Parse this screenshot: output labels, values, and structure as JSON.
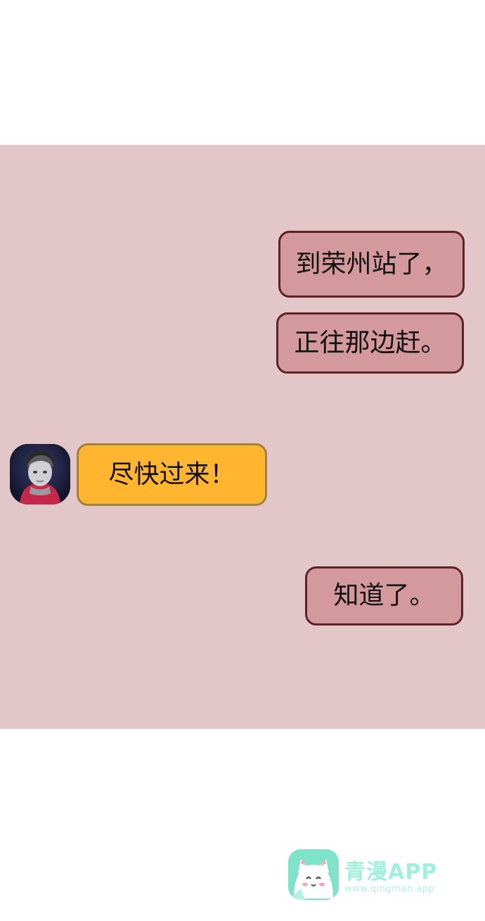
{
  "messages": [
    {
      "sender": "self",
      "text": "到荣州站了，"
    },
    {
      "sender": "self",
      "text": "正往那边赶。"
    },
    {
      "sender": "contact",
      "text": "尽快过来！"
    },
    {
      "sender": "self",
      "text": "知道了。"
    }
  ],
  "colors": {
    "chat_background": "#e3c6c7",
    "self_bubble": "#d3999c",
    "self_bubble_border": "#5b2228",
    "contact_bubble": "#ffb52f",
    "contact_bubble_border": "#9f8140"
  },
  "watermark": {
    "title": "青漫APP",
    "url": "www.qingman.app",
    "icon": "cat-face-icon"
  }
}
